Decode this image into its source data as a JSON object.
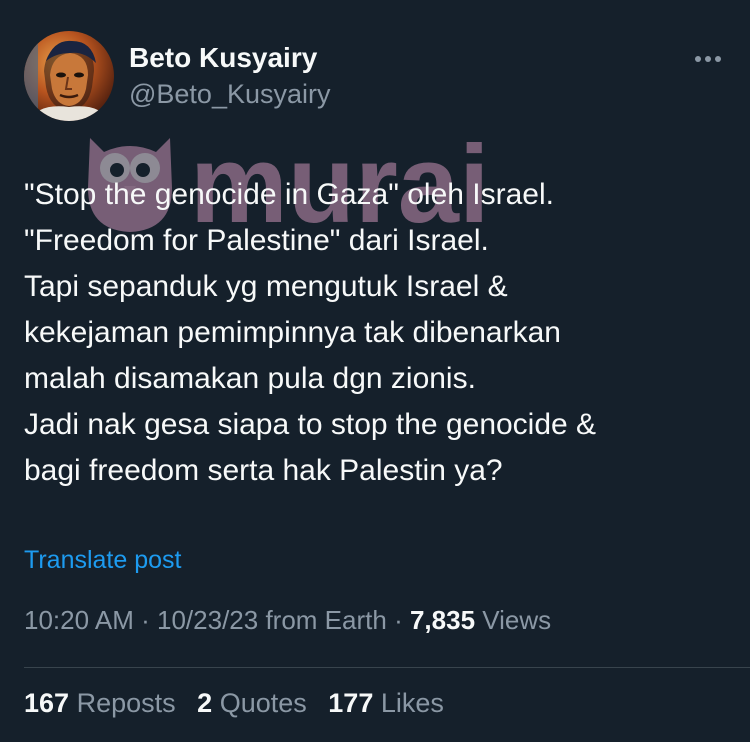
{
  "author": {
    "name": "Beto Kusyairy",
    "handle": "@Beto_Kusyairy"
  },
  "watermark": {
    "text": "murai"
  },
  "tweet": {
    "lines": [
      "\"Stop the genocide in Gaza\" oleh Israel.",
      "\"Freedom for Palestine\" dari Israel.",
      "Tapi sepanduk yg mengutuk Israel &",
      "kekejaman pemimpinnya tak dibenarkan",
      "malah disamakan pula dgn zionis.",
      "Jadi nak gesa siapa to stop the genocide &",
      "bagi freedom serta hak Palestin ya?"
    ]
  },
  "translate_label": "Translate post",
  "meta": {
    "time": "10:20 AM",
    "separator": "·",
    "date": "10/23/23",
    "source": "from Earth",
    "views_count": "7,835",
    "views_label": "Views"
  },
  "stats": {
    "reposts_count": "167",
    "reposts_label": "Reposts",
    "quotes_count": "2",
    "quotes_label": "Quotes",
    "likes_count": "177",
    "likes_label": "Likes"
  },
  "colors": {
    "background": "#15202b",
    "text": "#f7f9f9",
    "secondary": "#8b98a5",
    "link": "#1d9bf0",
    "watermark": "#c792b4"
  },
  "icons": {
    "more": "more-horizontal-icon",
    "watermark_logo": "owl-logo"
  }
}
